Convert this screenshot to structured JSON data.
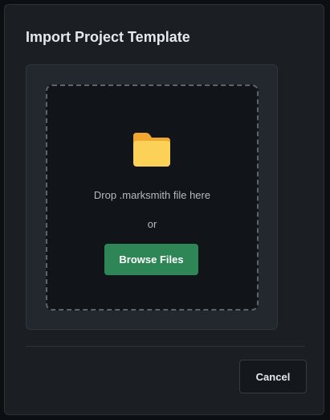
{
  "dialog": {
    "title": "Import Project Template",
    "dropzone": {
      "icon": "folder-icon",
      "drop_text": "Drop .marksmith file here",
      "or_text": "or",
      "browse_label": "Browse Files"
    },
    "cancel_label": "Cancel"
  },
  "colors": {
    "accent": "#2e8555",
    "folder": "#f5b93e",
    "background": "#1b1f24"
  }
}
